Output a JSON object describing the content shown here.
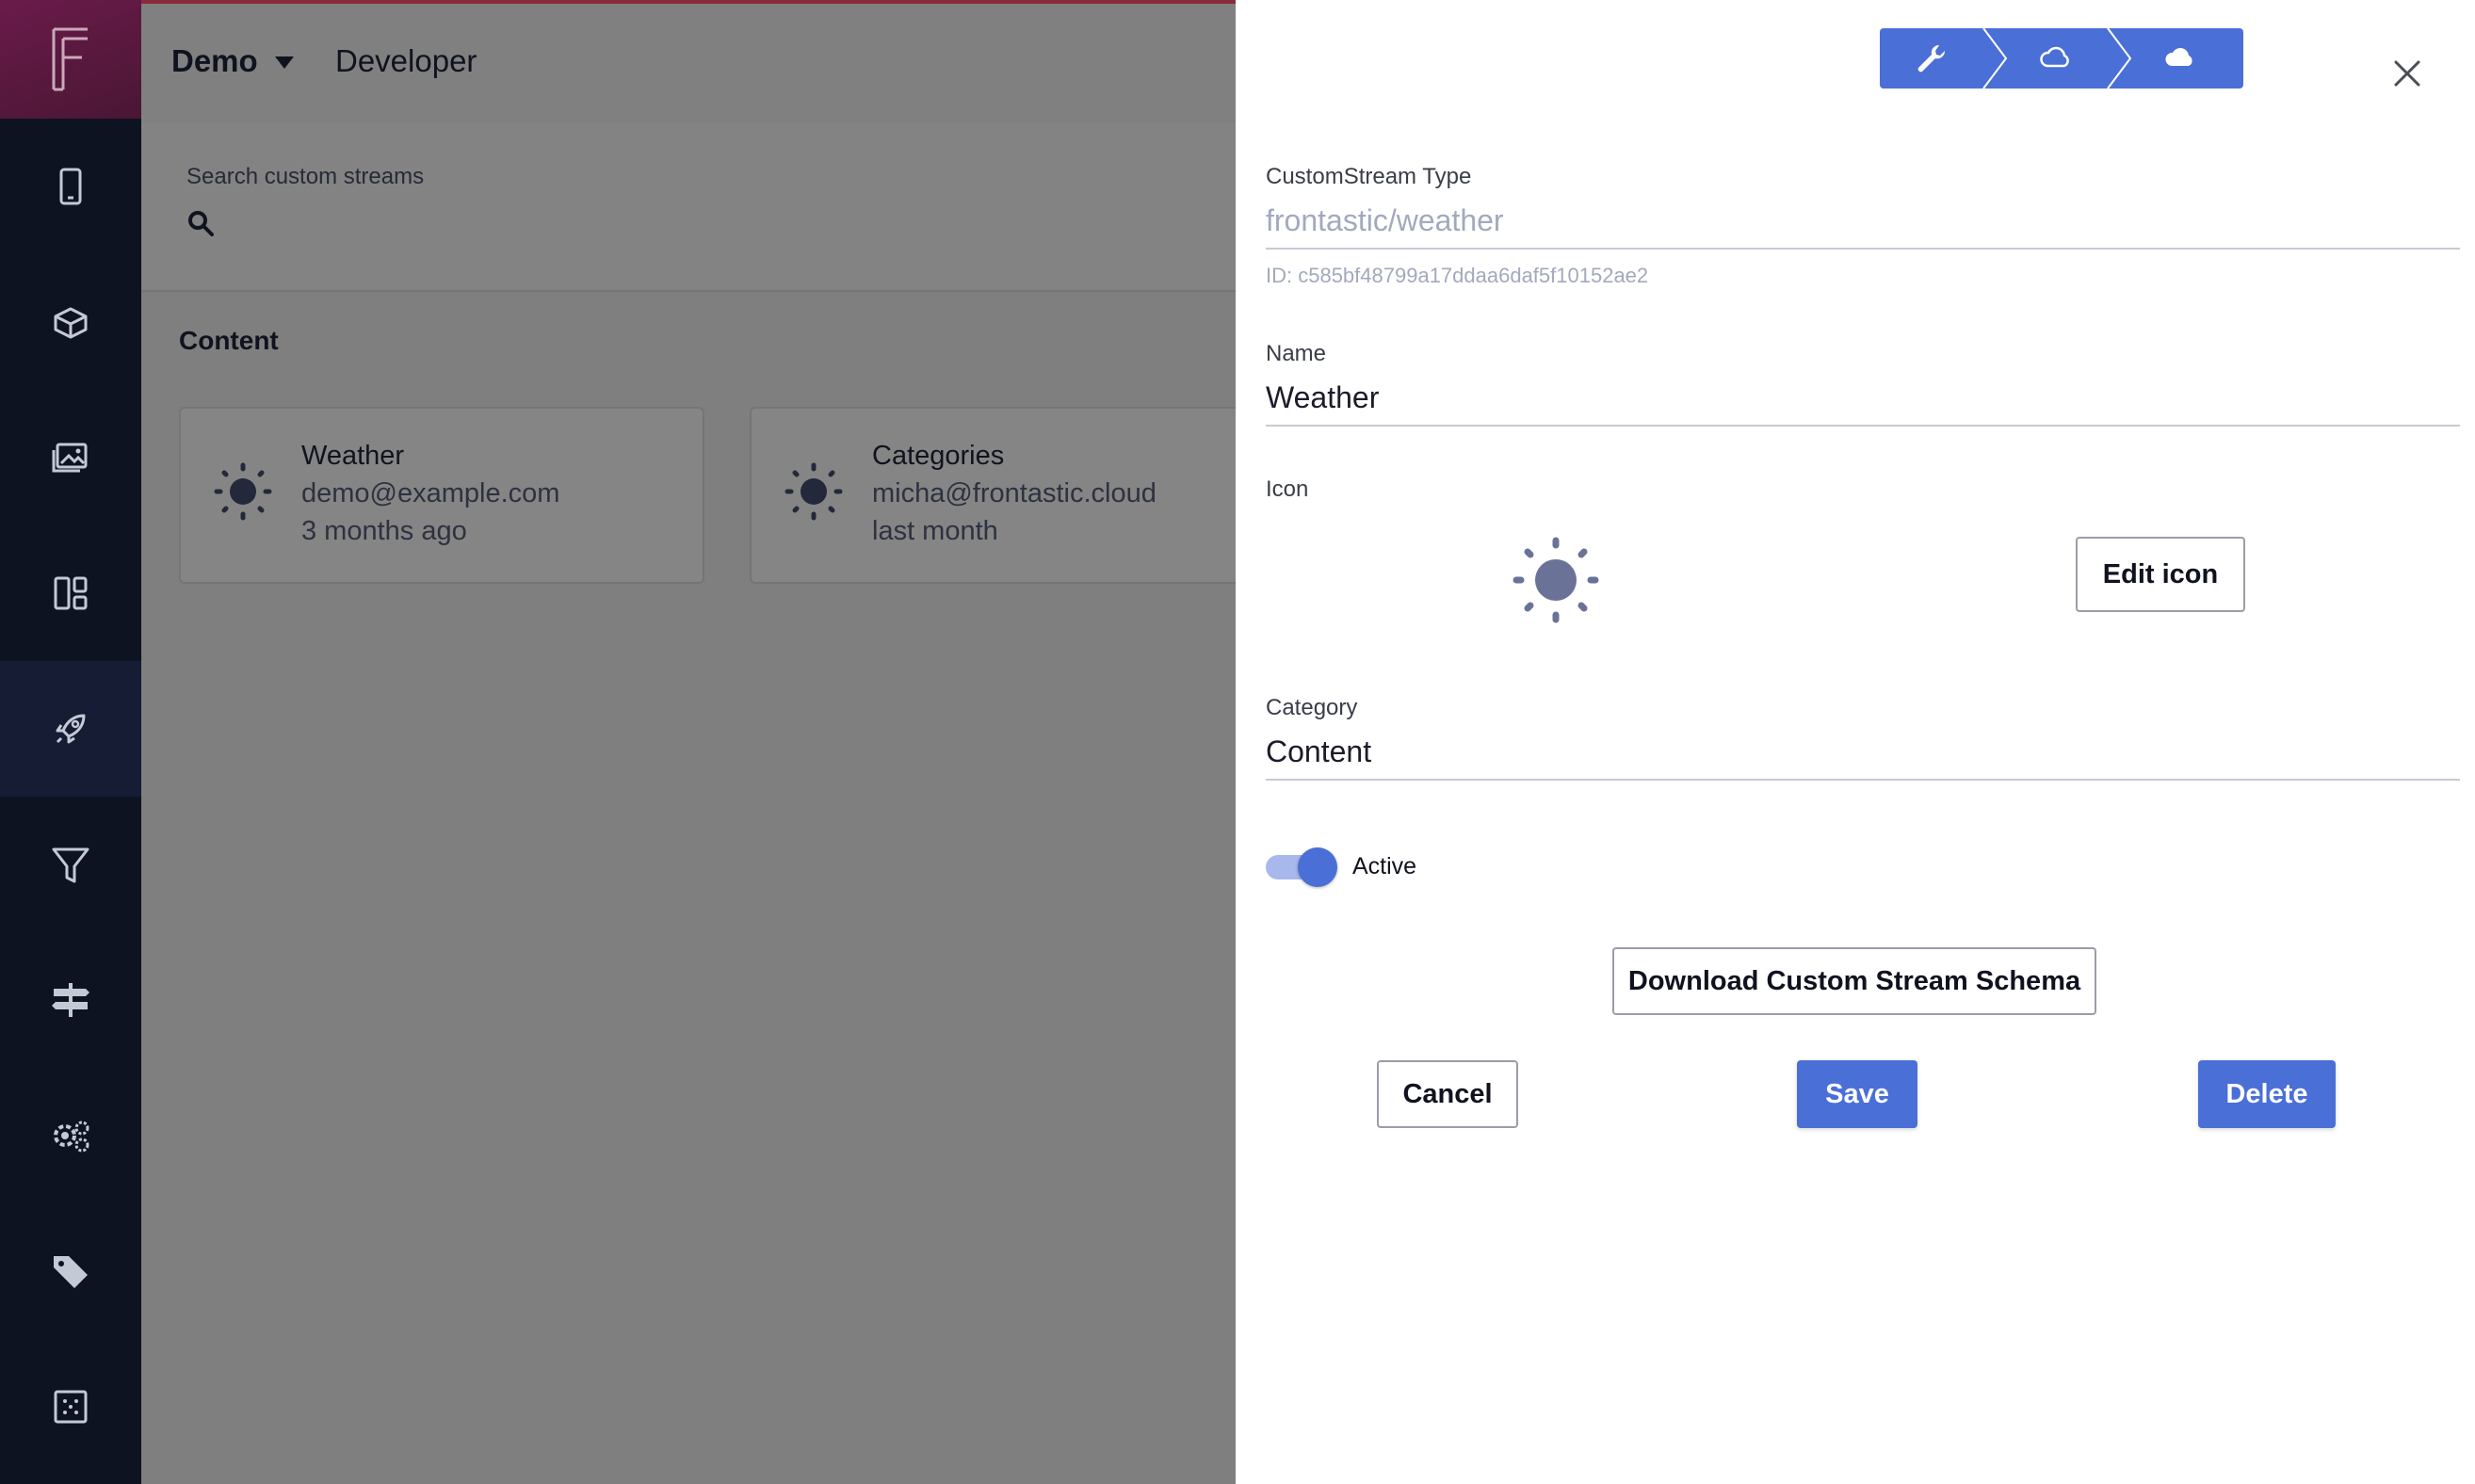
{
  "topbar": {
    "org": "Demo",
    "role": "Developer"
  },
  "search": {
    "label": "Search custom streams"
  },
  "section": {
    "title": "Content"
  },
  "cards": [
    {
      "title": "Weather",
      "email": "demo@example.com",
      "time": "3 months ago"
    },
    {
      "title": "Categories",
      "email": "micha@frontastic.cloud",
      "time": "last month"
    }
  ],
  "sidebar": {
    "items": [
      "phone-icon",
      "gift-box-icon",
      "image-gallery-icon",
      "layout-icon",
      "rocket-icon",
      "filter-icon",
      "signpost-icon",
      "gears-icon",
      "tag-icon",
      "grid-dots-icon"
    ],
    "active_index": 4
  },
  "drawer": {
    "type_label": "CustomStream Type",
    "type_value": "frontastic/weather",
    "id_hint": "ID: c585bf48799a17ddaa6daf5f10152ae2",
    "name_label": "Name",
    "name_value": "Weather",
    "icon_label": "Icon",
    "edit_icon_label": "Edit icon",
    "category_label": "Category",
    "category_value": "Content",
    "active_label": "Active",
    "active": true,
    "download_label": "Download Custom Stream Schema",
    "cancel_label": "Cancel",
    "save_label": "Save",
    "delete_label": "Delete"
  },
  "colors": {
    "sidebar_bg": "#0e1322",
    "brand_gradient": "#6a1b4a",
    "primary": "#4a6fd6",
    "overlay": "#7f7f7f"
  }
}
